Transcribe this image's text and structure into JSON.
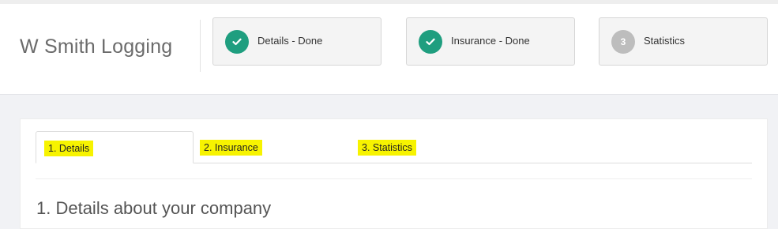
{
  "header": {
    "company_name": "W Smith Logging"
  },
  "steps": [
    {
      "number": "1",
      "label": "Details - Done",
      "status": "done",
      "icon": "check-icon"
    },
    {
      "number": "2",
      "label": "Insurance - Done",
      "status": "done",
      "icon": "check-icon"
    },
    {
      "number": "3",
      "label": "Statistics",
      "status": "pending",
      "icon": ""
    }
  ],
  "tabs": [
    {
      "label": "1. Details",
      "active": true
    },
    {
      "label": "2. Insurance",
      "active": false
    },
    {
      "label": "3. Statistics",
      "active": false
    }
  ],
  "main": {
    "section_heading": "1. Details about your company"
  },
  "colors": {
    "done": "#1f9e7f",
    "pending": "#bdbdbd",
    "highlight": "#f7f300"
  }
}
